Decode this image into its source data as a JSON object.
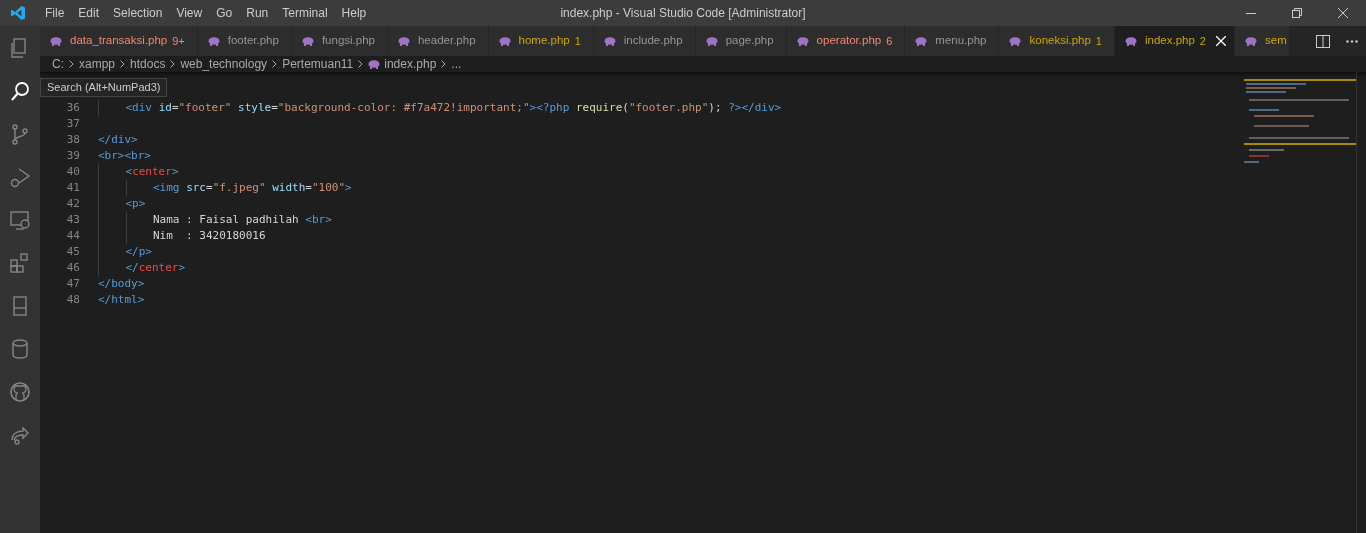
{
  "window": {
    "title": "index.php - Visual Studio Code [Administrator]"
  },
  "menu": [
    "File",
    "Edit",
    "Selection",
    "View",
    "Go",
    "Run",
    "Terminal",
    "Help"
  ],
  "tabs": [
    {
      "label": "data_transaksi.php",
      "badge": "9+",
      "color": "#f48771",
      "selected": false
    },
    {
      "label": "footer.php",
      "color": "#969696",
      "selected": false
    },
    {
      "label": "fungsi.php",
      "color": "#969696",
      "selected": false
    },
    {
      "label": "header.php",
      "color": "#969696",
      "selected": false
    },
    {
      "label": "home.php",
      "badge": "1",
      "color": "#cca700",
      "selected": false
    },
    {
      "label": "include.php",
      "color": "#969696",
      "selected": false
    },
    {
      "label": "page.php",
      "color": "#969696",
      "selected": false
    },
    {
      "label": "operator.php",
      "badge": "6",
      "color": "#f48771",
      "selected": false
    },
    {
      "label": "menu.php",
      "color": "#969696",
      "selected": false
    },
    {
      "label": "koneksi.php",
      "badge": "1",
      "color": "#cca700",
      "selected": false
    },
    {
      "label": "index.php",
      "badge": "2",
      "color": "#cca700",
      "selected": true
    },
    {
      "label": "sem",
      "color": "#cca700",
      "selected": false
    }
  ],
  "breadcrumb": [
    "C:",
    "xampp",
    "htdocs",
    "web_technology",
    "Pertemuan11",
    "index.php",
    "..."
  ],
  "tooltip": "Search (Alt+NumPad3)",
  "lines": [
    {
      "line_no": "36",
      "tokens": [
        {
          "kind": "tag",
          "text": "    <div "
        },
        {
          "kind": "attr",
          "text": "id"
        },
        {
          "kind": "plain",
          "text": "="
        },
        {
          "kind": "str",
          "text": "\"footer\" "
        },
        {
          "kind": "attr",
          "text": "style"
        },
        {
          "kind": "plain",
          "text": "="
        },
        {
          "kind": "str",
          "text": "\"background-color: #f7a472!important;\""
        },
        {
          "kind": "tag",
          "text": "><?php "
        },
        {
          "kind": "func",
          "text": "require"
        },
        {
          "kind": "plain",
          "text": "("
        },
        {
          "kind": "str",
          "text": "\"footer.php\""
        },
        {
          "kind": "plain",
          "text": "); "
        },
        {
          "kind": "tag",
          "text": "?></div>"
        }
      ]
    },
    {
      "line_no": "37"
    },
    {
      "line_no": "38",
      "tokens": [
        {
          "kind": "tag",
          "text": "</div>"
        }
      ]
    },
    {
      "line_no": "39",
      "tokens": [
        {
          "kind": "tag",
          "text": "<br><br>"
        }
      ]
    },
    {
      "line_no": "40",
      "tokens": [
        {
          "kind": "tag",
          "text": "    <"
        },
        {
          "kind": "err",
          "text": "center"
        },
        {
          "kind": "tag",
          "text": ">"
        }
      ]
    },
    {
      "line_no": "41",
      "tokens": [
        {
          "kind": "tag",
          "text": "        <img "
        },
        {
          "kind": "attr",
          "text": "src"
        },
        {
          "kind": "plain",
          "text": "="
        },
        {
          "kind": "str",
          "text": "\"f.jpeg\" "
        },
        {
          "kind": "attr",
          "text": "width"
        },
        {
          "kind": "plain",
          "text": "="
        },
        {
          "kind": "str",
          "text": "\"100\""
        },
        {
          "kind": "tag",
          "text": ">"
        }
      ]
    },
    {
      "line_no": "42",
      "tokens": [
        {
          "kind": "tag",
          "text": "    <p>"
        }
      ]
    },
    {
      "line_no": "43",
      "tokens": [
        {
          "kind": "plain",
          "text": "        Nama : Faisal padhilah "
        },
        {
          "kind": "tag",
          "text": "<br>"
        }
      ]
    },
    {
      "line_no": "44",
      "tokens": [
        {
          "kind": "plain",
          "text": "        Nim  : 3420180016"
        }
      ]
    },
    {
      "line_no": "45",
      "tokens": [
        {
          "kind": "tag",
          "text": "    </p>"
        }
      ]
    },
    {
      "line_no": "46",
      "tokens": [
        {
          "kind": "tag",
          "text": "    </"
        },
        {
          "kind": "err",
          "text": "center"
        },
        {
          "kind": "tag",
          "text": ">"
        }
      ]
    },
    {
      "line_no": "47",
      "tokens": [
        {
          "kind": "tag",
          "text": "</body>"
        }
      ]
    },
    {
      "line_no": "48",
      "tokens": [
        {
          "kind": "tag",
          "text": "</html>"
        }
      ]
    }
  ]
}
